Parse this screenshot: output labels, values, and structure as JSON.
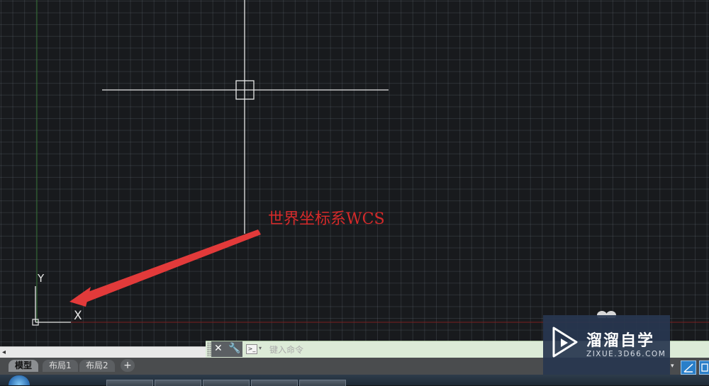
{
  "canvas": {
    "annotation_label": "世界坐标系WCS",
    "ucs_y_label": "Y",
    "ucs_x_label": "X",
    "background_color": "#181a1d",
    "grid_color": "#5a6470",
    "crosshair_color": "#e8e8e8",
    "annotation_color": "#d42a2a"
  },
  "command_line": {
    "placeholder": "键入命令",
    "close_icon": "close-icon",
    "settings_icon": "wrench-icon",
    "prompt_icon": "command-prompt-icon"
  },
  "layout_tabs": {
    "model": "模型",
    "layout1": "布局1",
    "layout2": "布局2",
    "add_label": "+"
  },
  "scrollbar": {
    "left_arrow": "◂"
  },
  "watermark": {
    "title": "溜溜自学",
    "subtitle": "ZIXUE.3D66.COM",
    "logo_icon": "play-icon"
  },
  "status_bar": {
    "dropdown_icon": "▾"
  },
  "taskbar": {
    "start_icon": "windows-start-icon"
  }
}
